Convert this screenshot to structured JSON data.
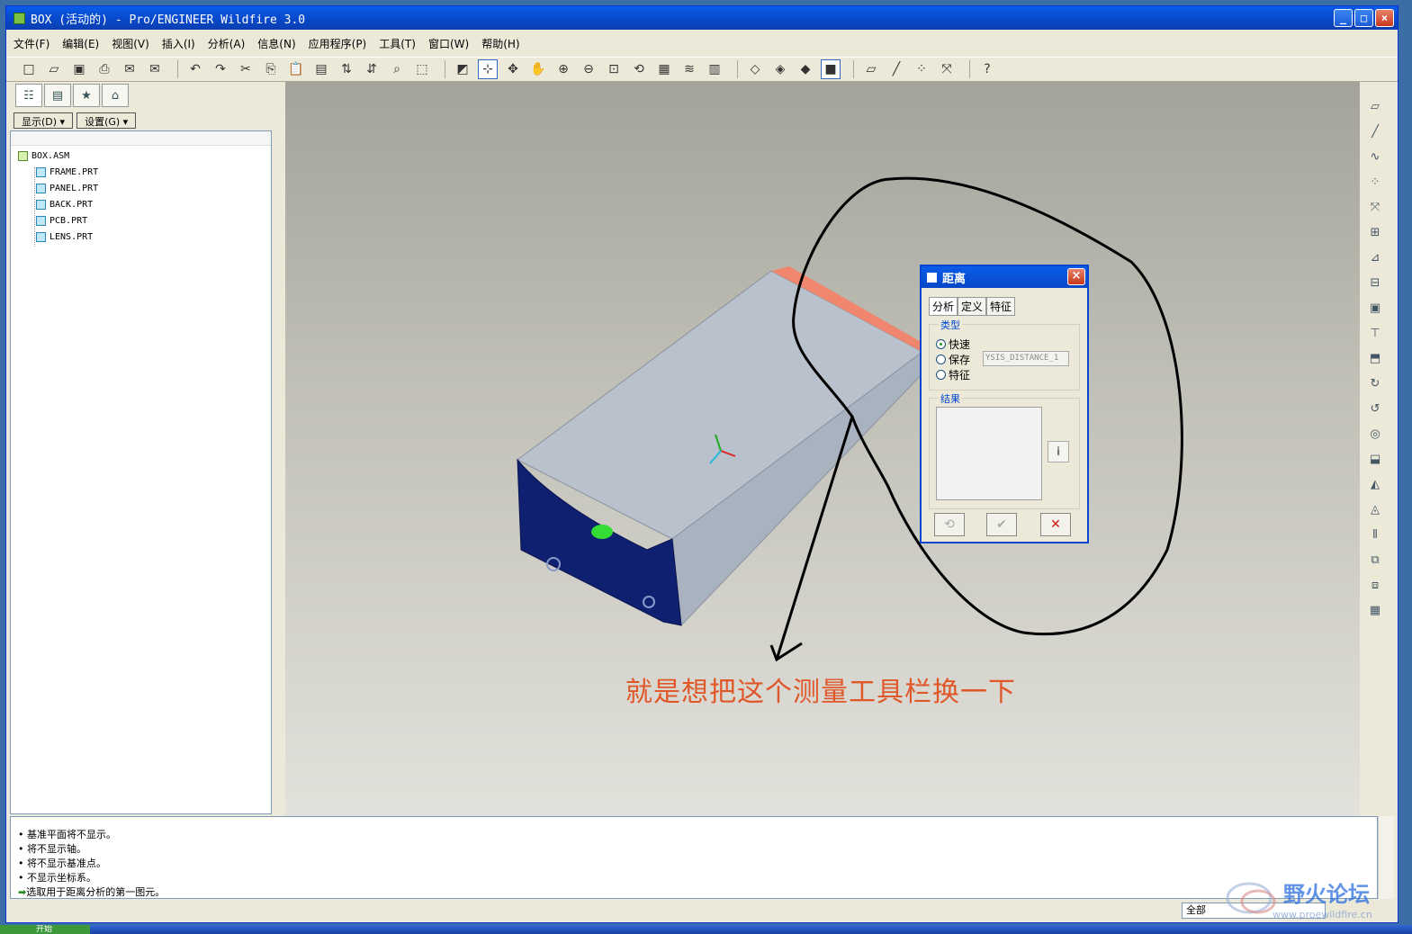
{
  "window": {
    "title": "BOX (活动的) - Pro/ENGINEER Wildfire 3.0"
  },
  "menu": [
    "文件(F)",
    "编辑(E)",
    "视图(V)",
    "插入(I)",
    "分析(A)",
    "信息(N)",
    "应用程序(P)",
    "工具(T)",
    "窗口(W)",
    "帮助(H)"
  ],
  "nav": {
    "show_btn": "显示(D) ▾",
    "settings_btn": "设置(G) ▾"
  },
  "tree": {
    "root": "BOX.ASM",
    "children": [
      "FRAME.PRT",
      "PANEL.PRT",
      "BACK.PRT",
      "PCB.PRT",
      "LENS.PRT"
    ]
  },
  "dialog": {
    "title": "距离",
    "tabs": [
      "分析",
      "定义",
      "特征"
    ],
    "type_label": "类型",
    "options": [
      "快速",
      "保存",
      "特征"
    ],
    "selected_option": "快速",
    "name_value": "YSIS_DISTANCE_1",
    "result_label": "结果"
  },
  "annotation": "就是想把这个测量工具栏换一下",
  "messages": [
    "基准平面将不显示。",
    "将不显示轴。",
    "将不显示基准点。",
    "不显示坐标系。",
    "选取用于距离分析的第一图元。"
  ],
  "status": {
    "filter": "全部"
  },
  "watermark": {
    "title": "野火论坛",
    "url": "www.proewildfire.cn"
  },
  "taskbar": {
    "start": "开始"
  }
}
